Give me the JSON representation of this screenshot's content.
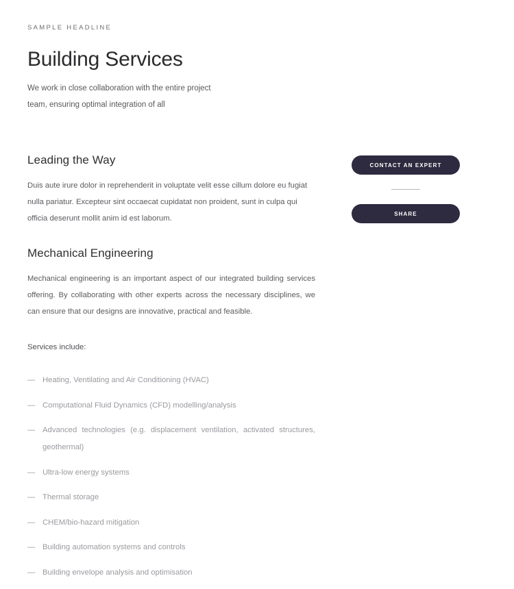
{
  "page": {
    "background": "#ffffff",
    "accent_color": "#2e2a3f"
  },
  "header": {
    "eyebrow": "SAMPLE HEADLINE",
    "title": "Building Services",
    "intro": "We work in close collaboration with the entire project team, ensuring optimal integration of all"
  },
  "sections": [
    {
      "title": "Leading the Way",
      "body": "Duis aute irure dolor in reprehenderit in voluptate velit esse cillum dolore eu fugiat nulla pariatur. Excepteur sint occaecat cupidatat non proident, sunt in culpa qui officia deserunt mollit anim id est laborum."
    },
    {
      "title": "Mechanical Engineering",
      "body": "Mechanical engineering is an important aspect of our integrated building services offering. By collaborating with other experts across the necessary disciplines, we can ensure that our designs are innovative, practical and feasible."
    }
  ],
  "services": {
    "lead": "Services include:",
    "marker": "—",
    "items": [
      "Heating, Ventilating and Air Conditioning (HVAC)",
      "Computational Fluid Dynamics (CFD) modelling/analysis",
      "Advanced technologies (e.g. displacement ventilation, activated structures, geothermal)",
      "Ultra-low energy systems",
      "Thermal storage",
      "CHEM/bio-hazard mitigation",
      "Building automation systems and controls",
      "Building envelope analysis and optimisation"
    ]
  },
  "aside": {
    "contact_button": "CONTACT AN EXPERT",
    "share_button": "SHARE"
  }
}
